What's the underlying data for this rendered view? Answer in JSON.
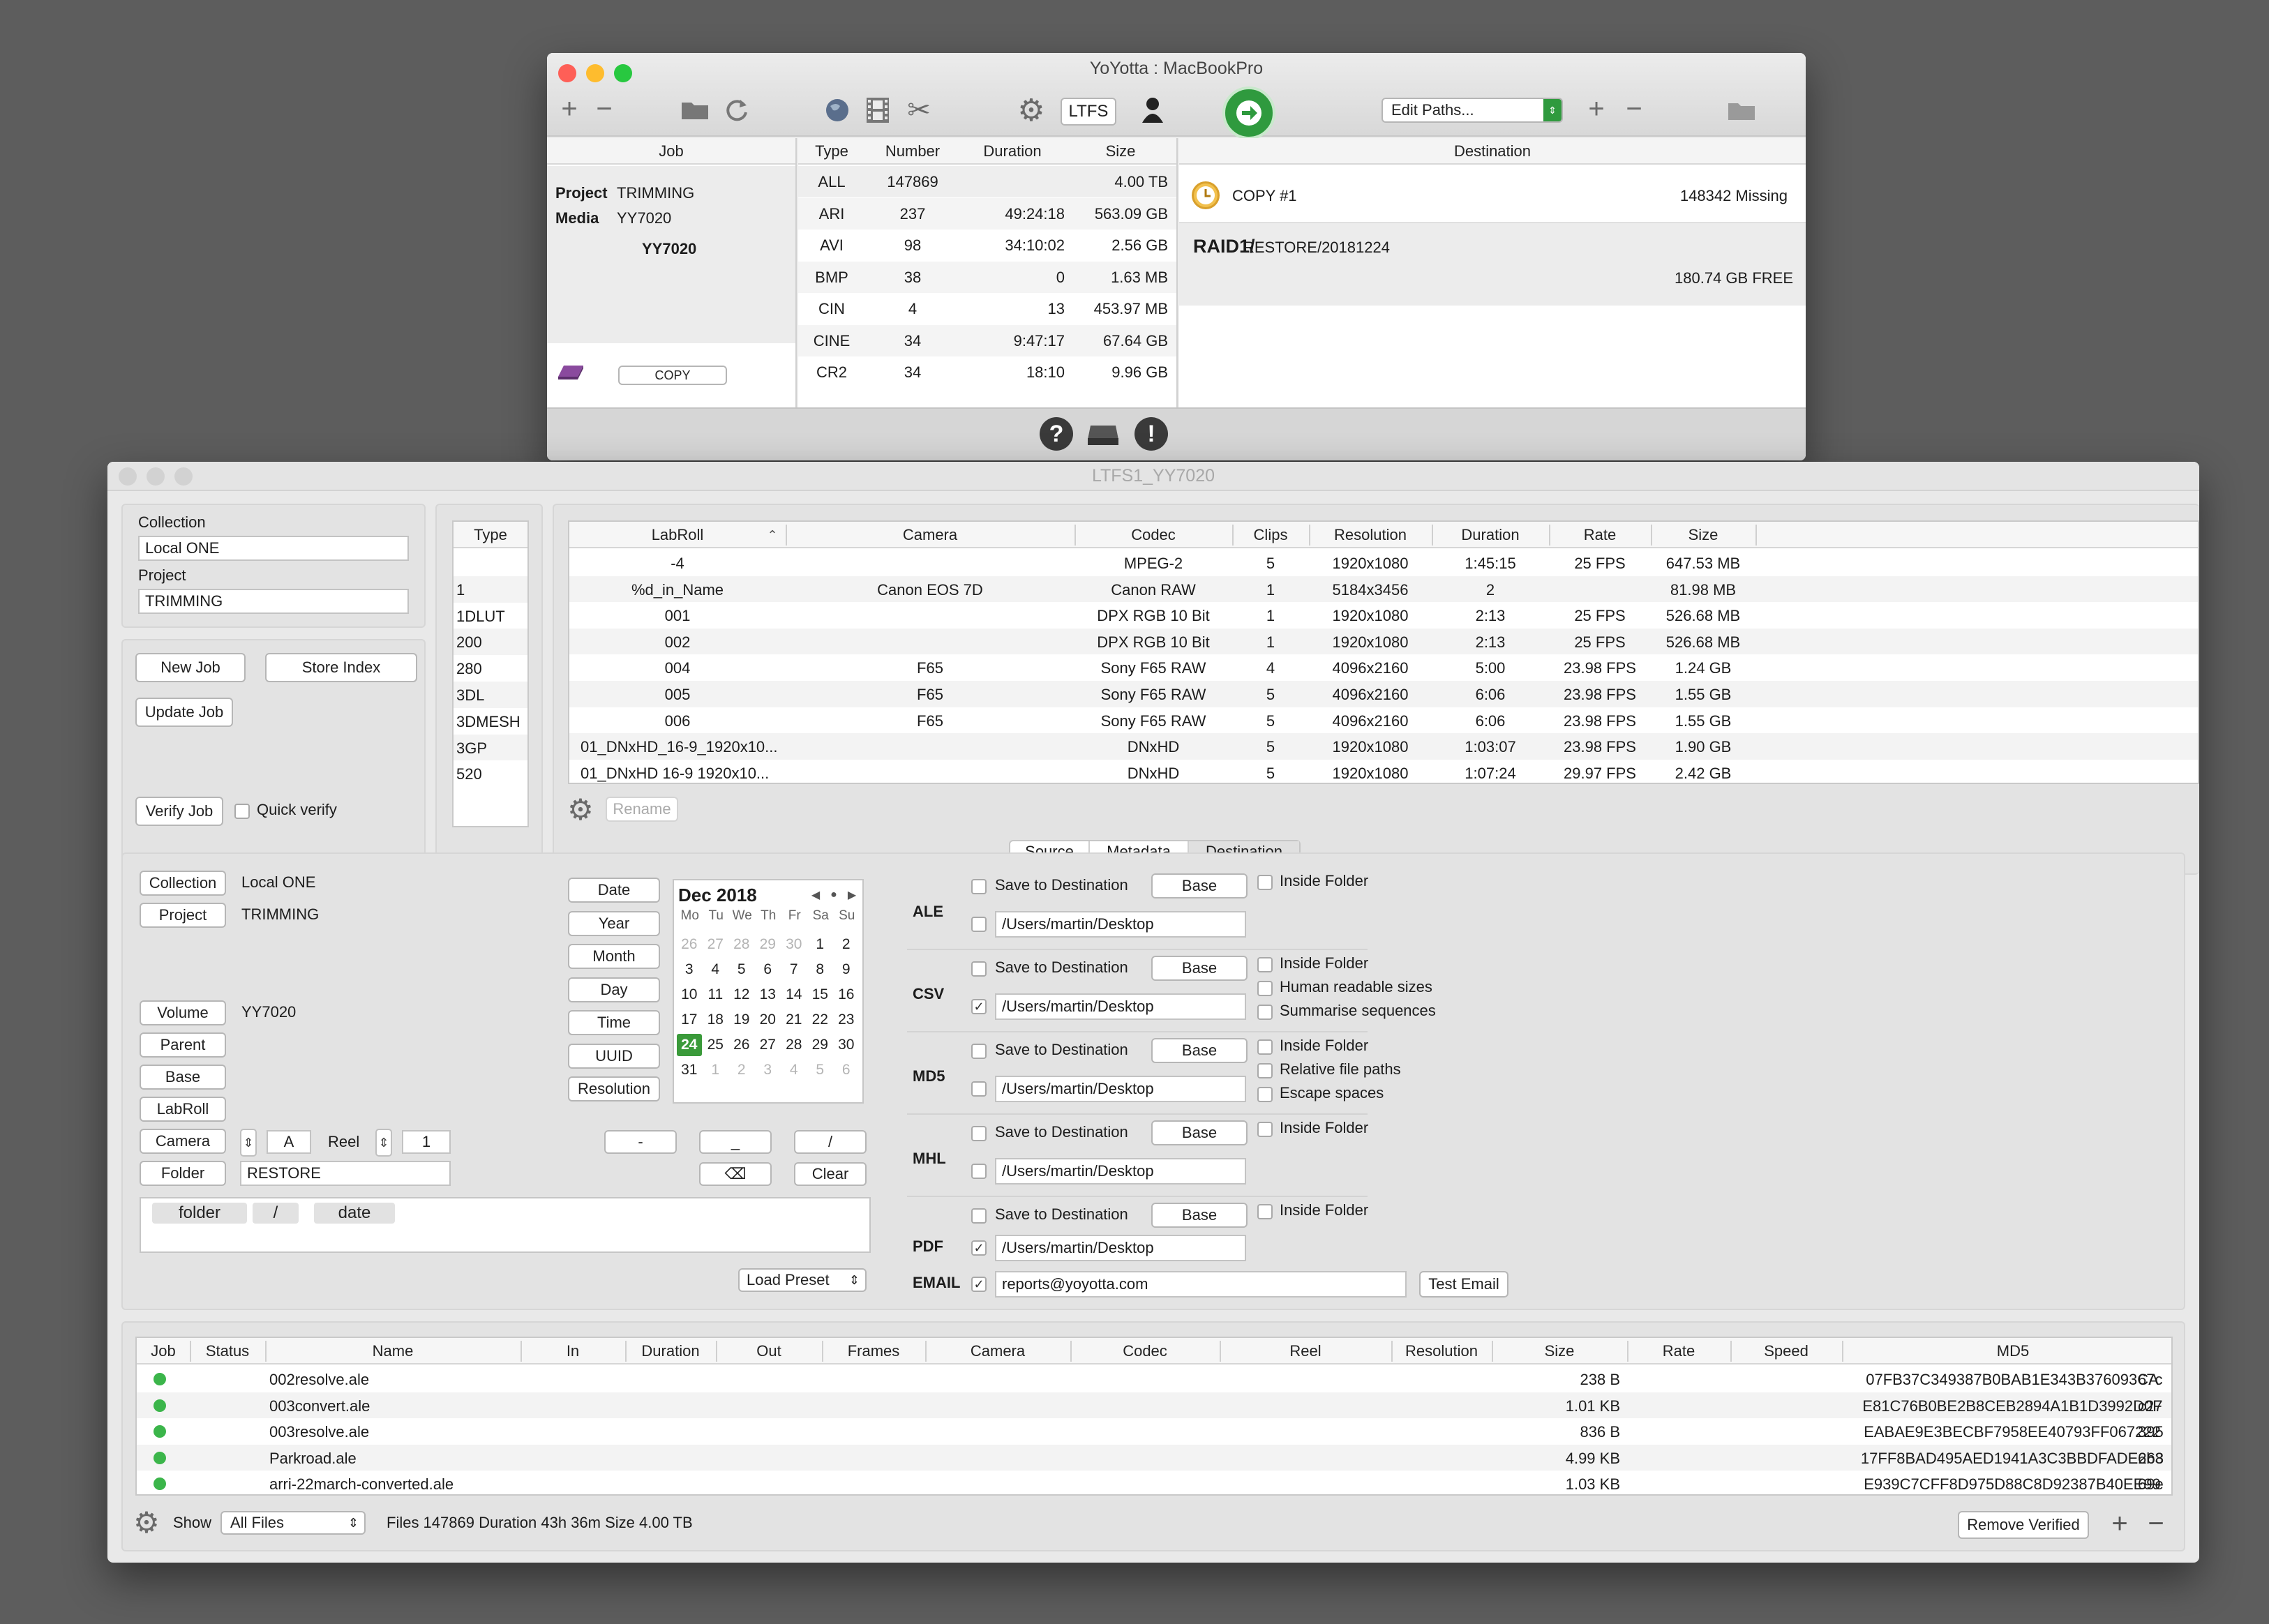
{
  "top_window": {
    "title": "YoYotta : MacBookPro",
    "toolbar": {
      "ltfs_label": "LTFS",
      "edit_paths": "Edit Paths..."
    },
    "job_header": "Job",
    "project_label": "Project",
    "project_value": "TRIMMING",
    "media_label": "Media",
    "media_value": "YY7020",
    "media_title": "YY7020",
    "copy_button": "COPY",
    "table_headers": [
      "Type",
      "Number",
      "Duration",
      "Size"
    ],
    "rows": [
      {
        "type": "ALL",
        "number": "147869",
        "duration": "",
        "size": "4.00 TB"
      },
      {
        "type": "ARI",
        "number": "237",
        "duration": "49:24:18",
        "size": "563.09 GB"
      },
      {
        "type": "AVI",
        "number": "98",
        "duration": "34:10:02",
        "size": "2.56 GB"
      },
      {
        "type": "BMP",
        "number": "38",
        "duration": "0",
        "size": "1.63 MB"
      },
      {
        "type": "CIN",
        "number": "4",
        "duration": "13",
        "size": "453.97 MB"
      },
      {
        "type": "CINE",
        "number": "34",
        "duration": "9:47:17",
        "size": "67.64 GB"
      },
      {
        "type": "CR2",
        "number": "34",
        "duration": "18:10",
        "size": "9.96 GB"
      }
    ],
    "destination_header": "Destination",
    "copy_name": "COPY #1",
    "missing": "148342 Missing",
    "raid_bold": "RAID1/",
    "raid_path": "RESTORE/20181224",
    "free": "180.74 GB FREE"
  },
  "main_window": {
    "title": "LTFS1_YY7020",
    "collection_label": "Collection",
    "collection_value": "Local ONE",
    "project_label": "Project",
    "project_value": "TRIMMING",
    "new_job": "New Job",
    "store_index": "Store Index",
    "update_job": "Update Job",
    "verify_job": "Verify Job",
    "quick_verify": "Quick verify",
    "type_header": "Type",
    "types": [
      "",
      "1",
      "1DLUT",
      "200",
      "280",
      "3DL",
      "3DMESH",
      "3GP",
      "520"
    ],
    "lab_headers": [
      "LabRoll",
      "Camera",
      "Codec",
      "Clips",
      "Resolution",
      "Duration",
      "Rate",
      "Size"
    ],
    "lab_rows": [
      {
        "labroll": "-4",
        "camera": "",
        "codec": "MPEG-2",
        "clips": "5",
        "resolution": "1920x1080",
        "duration": "1:45:15",
        "rate": "25 FPS",
        "size": "647.53 MB"
      },
      {
        "labroll": "%d_in_Name",
        "camera": "Canon EOS 7D",
        "codec": "Canon RAW",
        "clips": "1",
        "resolution": "5184x3456",
        "duration": "2",
        "rate": "",
        "size": "81.98 MB"
      },
      {
        "labroll": "001",
        "camera": "",
        "codec": "DPX RGB 10 Bit",
        "clips": "1",
        "resolution": "1920x1080",
        "duration": "2:13",
        "rate": "25 FPS",
        "size": "526.68 MB"
      },
      {
        "labroll": "002",
        "camera": "",
        "codec": "DPX RGB 10 Bit",
        "clips": "1",
        "resolution": "1920x1080",
        "duration": "2:13",
        "rate": "25 FPS",
        "size": "526.68 MB"
      },
      {
        "labroll": "004",
        "camera": "F65",
        "codec": "Sony F65 RAW",
        "clips": "4",
        "resolution": "4096x2160",
        "duration": "5:00",
        "rate": "23.98 FPS",
        "size": "1.24 GB"
      },
      {
        "labroll": "005",
        "camera": "F65",
        "codec": "Sony F65 RAW",
        "clips": "5",
        "resolution": "4096x2160",
        "duration": "6:06",
        "rate": "23.98 FPS",
        "size": "1.55 GB"
      },
      {
        "labroll": "006",
        "camera": "F65",
        "codec": "Sony F65 RAW",
        "clips": "5",
        "resolution": "4096x2160",
        "duration": "6:06",
        "rate": "23.98 FPS",
        "size": "1.55 GB"
      },
      {
        "labroll": "01_DNxHD_16-9_1920x10...",
        "camera": "",
        "codec": "DNxHD",
        "clips": "5",
        "resolution": "1920x1080",
        "duration": "1:03:07",
        "rate": "23.98 FPS",
        "size": "1.90 GB"
      },
      {
        "labroll": "01_DNxHD 16-9 1920x10...",
        "camera": "",
        "codec": "DNxHD",
        "clips": "5",
        "resolution": "1920x1080",
        "duration": "1:07:24",
        "rate": "29.97 FPS",
        "size": "2.42 GB"
      }
    ],
    "rename": "Rename",
    "tabs": [
      "Source",
      "Metadata",
      "Destination"
    ],
    "naming": {
      "collection_btn": "Collection",
      "collection_val": "Local ONE",
      "project_btn": "Project",
      "project_val": "TRIMMING",
      "volume_btn": "Volume",
      "volume_val": "YY7020",
      "parent_btn": "Parent",
      "base_btn": "Base",
      "labroll_btn": "LabRoll",
      "camera_btn": "Camera",
      "camera_val": "A",
      "reel_label": "Reel",
      "reel_val": "1",
      "folder_btn": "Folder",
      "folder_val": "RESTORE",
      "tokens": [
        "folder",
        "/",
        "date"
      ],
      "date_buttons": [
        "Date",
        "Year",
        "Month",
        "Day",
        "Time",
        "UUID",
        "Resolution"
      ],
      "sep_dash": "-",
      "sep_underscore": "_",
      "sep_slash": "/",
      "clear": "Clear",
      "load_preset": "Load Preset"
    },
    "calendar": {
      "month": "Dec 2018",
      "days": [
        "Mo",
        "Tu",
        "We",
        "Th",
        "Fr",
        "Sa",
        "Su"
      ],
      "weeks": [
        [
          "26",
          "27",
          "28",
          "29",
          "30",
          "1",
          "2"
        ],
        [
          "3",
          "4",
          "5",
          "6",
          "7",
          "8",
          "9"
        ],
        [
          "10",
          "11",
          "12",
          "13",
          "14",
          "15",
          "16"
        ],
        [
          "17",
          "18",
          "19",
          "20",
          "21",
          "22",
          "23"
        ],
        [
          "24",
          "25",
          "26",
          "27",
          "28",
          "29",
          "30"
        ],
        [
          "31",
          "1",
          "2",
          "3",
          "4",
          "5",
          "6"
        ]
      ],
      "selected": "24"
    },
    "reports": {
      "save_to_destination": "Save to Destination",
      "base": "Base",
      "inside_folder": "Inside Folder",
      "path": "/Users/martin/Desktop",
      "ale": "ALE",
      "csv": "CSV",
      "md5": "MD5",
      "mhl": "MHL",
      "pdf": "PDF",
      "email": "EMAIL",
      "human_readable": "Human readable sizes",
      "summarise": "Summarise sequences",
      "relative": "Relative file paths",
      "escape": "Escape spaces",
      "email_value": "reports@yoyotta.com",
      "test_email": "Test Email"
    },
    "job_headers": [
      "Job",
      "Status",
      "Name",
      "In",
      "Duration",
      "Out",
      "Frames",
      "Camera",
      "Codec",
      "Reel",
      "Resolution",
      "Size",
      "Rate",
      "Speed",
      "MD5"
    ],
    "job_rows": [
      {
        "name": "002resolve.ale",
        "size": "238 B",
        "md5": "07FB37C349387B0BAB1E343B376093CA",
        "tail": "67c"
      },
      {
        "name": "003convert.ale",
        "size": "1.01 KB",
        "md5": "E81C76B0BE2B8CEB2894A1B1D3992D0F",
        "tail": "c27"
      },
      {
        "name": "003resolve.ale",
        "size": "836 B",
        "md5": "EABAE9E3BECBF7958EE40793FF067222",
        "tail": "395"
      },
      {
        "name": "Parkroad.ale",
        "size": "4.99 KB",
        "md5": "17FF8BAD495AED1941A3C3BBDFADE268",
        "tail": "6b3"
      },
      {
        "name": "arri-22march-converted.ale",
        "size": "1.03 KB",
        "md5": "E939C7CFF8D975D88C8D92387B40EE99",
        "tail": "69e"
      }
    ],
    "show_label": "Show",
    "show_value": "All Files",
    "status_text": "Files 147869 Duration 43h 36m Size 4.00 TB",
    "remove_verified": "Remove Verified"
  },
  "colors": {
    "green": "#3bb54a",
    "go_button": "#2f9a3e",
    "selected_day": "#3a9a3a",
    "desktop": "#5d5d5d"
  }
}
